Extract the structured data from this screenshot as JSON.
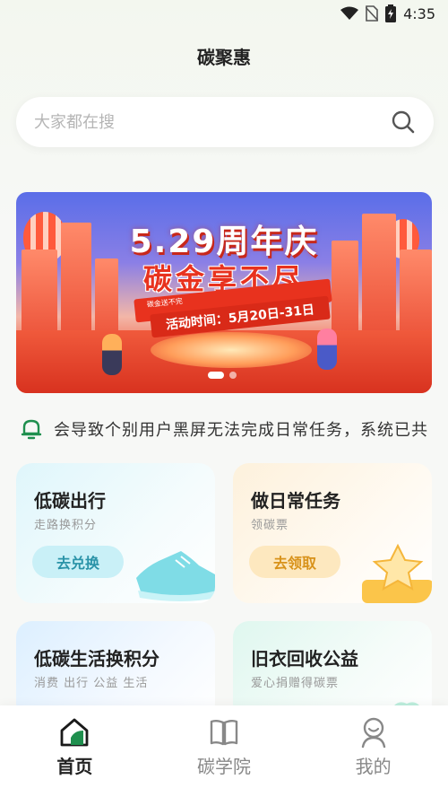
{
  "status_bar": {
    "time": "4:35",
    "battery_level": 0.85
  },
  "header": {
    "title": "碳聚惠"
  },
  "search": {
    "placeholder": "大家都在搜"
  },
  "banner": {
    "headline": "5.29周年庆",
    "subline": "碳金享不尽",
    "ribbon_small": "碳金送不完",
    "ribbon_dates": "活动时间：5月20日-31日",
    "active_slide": 1,
    "slide_count": 2
  },
  "notice": {
    "text": "会导致个别用户黑屏无法完成日常任务，系统已共"
  },
  "cards": [
    {
      "title": "低碳出行",
      "subtitle": "走路换积分",
      "button": "去兑换"
    },
    {
      "title": "做日常任务",
      "subtitle": "领碳票",
      "button": "去领取"
    },
    {
      "title": "低碳生活换积分",
      "subtitle": "消费 出行 公益 生活"
    },
    {
      "title": "旧衣回收公益",
      "subtitle": "爱心捐赠得碳票"
    }
  ],
  "tabbar": {
    "items": [
      {
        "label": "首页",
        "icon": "home-icon",
        "active": true
      },
      {
        "label": "碳学院",
        "icon": "book-icon",
        "active": false
      },
      {
        "label": "我的",
        "icon": "profile-icon",
        "active": false
      }
    ]
  },
  "colors": {
    "accent_green": "#1f8f4e",
    "banner_red": "#e8321e"
  }
}
